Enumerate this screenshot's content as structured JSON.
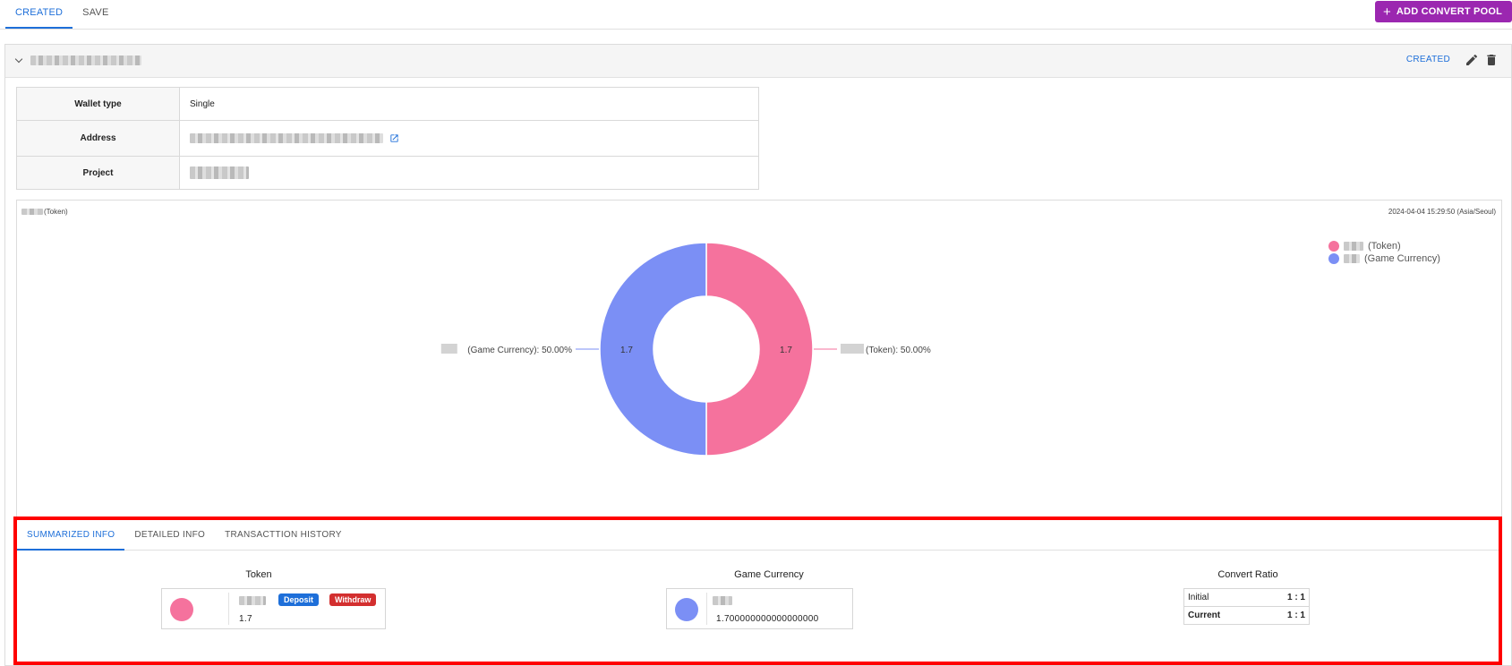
{
  "top_tabs": {
    "created": "CREATED",
    "save": "SAVE"
  },
  "add_button": {
    "label": "ADD CONVERT POOL"
  },
  "panel": {
    "status": "CREATED"
  },
  "info_table": {
    "wallet_type_label": "Wallet type",
    "wallet_type_value": "Single",
    "address_label": "Address",
    "project_label": "Project"
  },
  "chart_data": {
    "type": "pie",
    "title_suffix": "(Token)",
    "timestamp": "2024-04-04 15:29:50 (Asia/Seoul)",
    "slices": [
      {
        "name": "(Token)",
        "value": 1.7,
        "percent": "50.00%",
        "color": "#f5729d",
        "label": "(Token): 50.00%",
        "value_label": "1.7"
      },
      {
        "name": "(Game Currency)",
        "value": 1.7,
        "percent": "50.00%",
        "color": "#7b8ff5",
        "label": "(Game Currency): 50.00%",
        "value_label": "1.7"
      }
    ],
    "legend": [
      {
        "label": "(Token)",
        "color": "#f5729d"
      },
      {
        "label": "(Game Currency)",
        "color": "#7b8ff5"
      }
    ],
    "legend_position": "top-right",
    "donut": true
  },
  "sub_tabs": {
    "summarized": "SUMMARIZED INFO",
    "detailed": "DETAILED INFO",
    "history": "TRANSACTTION HISTORY"
  },
  "summary": {
    "token_title": "Token",
    "token_amount": "1.7",
    "deposit_label": "Deposit",
    "withdraw_label": "Withdraw",
    "game_currency_title": "Game Currency",
    "game_currency_amount": "1.700000000000000000",
    "convert_ratio_title": "Convert Ratio",
    "initial_label": "Initial",
    "initial_value": "1 : 1",
    "current_label": "Current",
    "current_value": "1 : 1"
  },
  "colors": {
    "accent": "#1e6fd9",
    "add_button": "#9b27b0",
    "token": "#f5729d",
    "game_currency": "#7b8ff5",
    "deposit": "#1e6fd9",
    "withdraw": "#d32f2f",
    "highlight": "#ff0000"
  },
  "icons": {
    "add": "plus-icon",
    "collapse": "chevron-down-icon",
    "edit": "pencil-icon",
    "delete": "trash-icon",
    "open": "external-link-icon"
  }
}
